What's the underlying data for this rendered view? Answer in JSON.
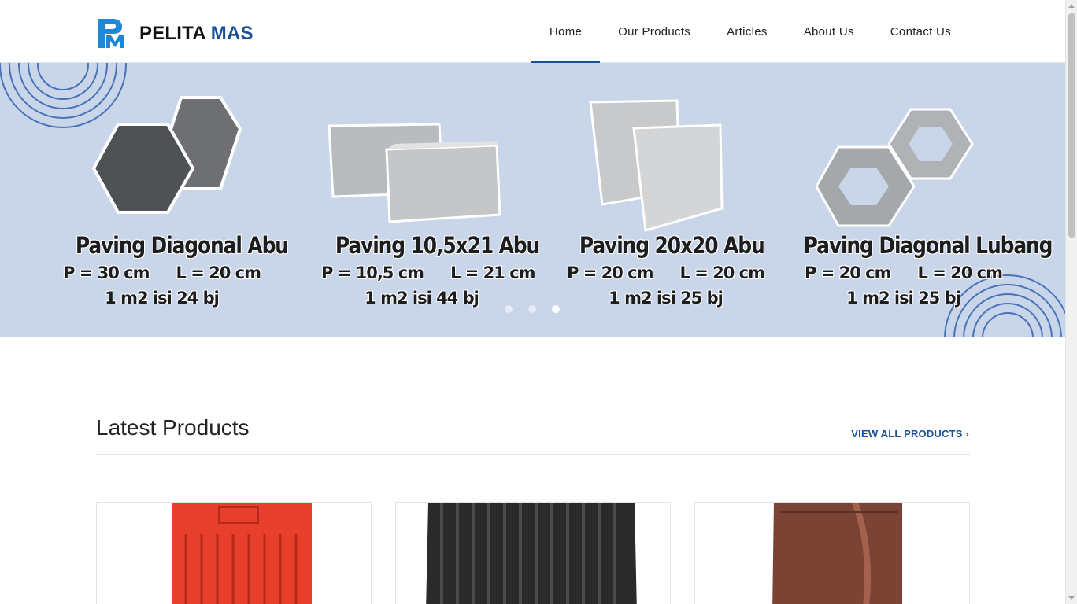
{
  "brand": {
    "name_part1": "PELITA",
    "name_part2": "MAS",
    "color_primary": "#1a4f9c",
    "color_logo": "#1e88d6"
  },
  "nav": {
    "items": [
      {
        "label": "Home",
        "active": true
      },
      {
        "label": "Our Products",
        "active": false
      },
      {
        "label": "Articles",
        "active": false
      },
      {
        "label": "About Us",
        "active": false
      },
      {
        "label": "Contact Us",
        "active": false
      }
    ]
  },
  "hero": {
    "background": "#c9d6ea",
    "products": [
      {
        "name": "Paving Diagonal Abu",
        "p": "P = 30 cm",
        "l": "L = 20 cm",
        "qty": "1 m2 isi 24 bj"
      },
      {
        "name": "Paving 10,5x21 Abu",
        "p": "P = 10,5 cm",
        "l": "L = 21 cm",
        "qty": "1 m2 isi 44 bj"
      },
      {
        "name": "Paving 20x20 Abu",
        "p": "P = 20 cm",
        "l": "L = 20 cm",
        "qty": "1 m2 isi 25 bj"
      },
      {
        "name": "Paving Diagonal Lubang",
        "p": "P = 20 cm",
        "l": "L = 20 cm",
        "qty": "1 m2 isi 25 bj"
      }
    ],
    "slider": {
      "count": 3,
      "active_index": 2
    }
  },
  "latest": {
    "title": "Latest Products",
    "view_all": "VIEW ALL PRODUCTS ›",
    "cards": [
      {
        "icon": "red-roof-tile-image"
      },
      {
        "icon": "black-roof-tile-image"
      },
      {
        "icon": "brown-roof-tile-image"
      }
    ]
  }
}
